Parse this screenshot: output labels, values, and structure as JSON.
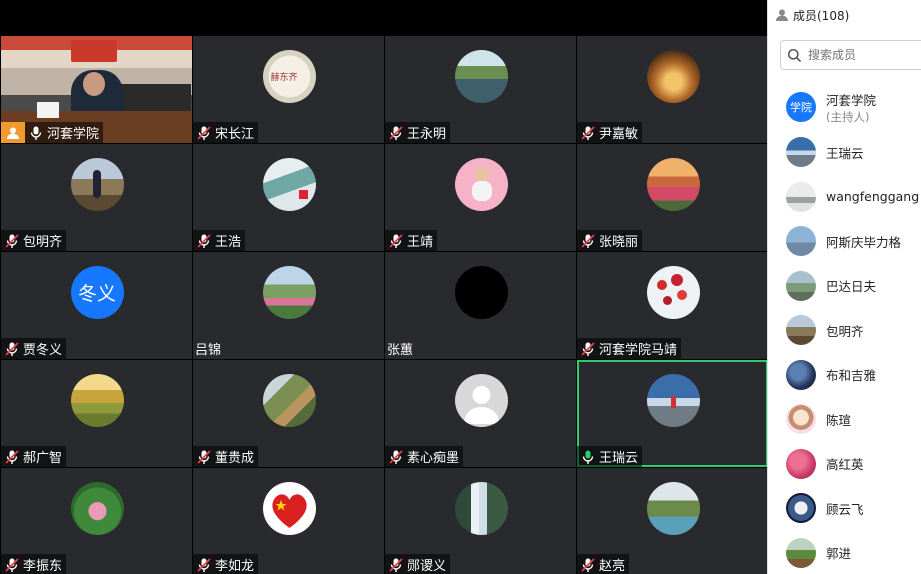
{
  "colors": {
    "tile_bg": "#292a2e",
    "active_border": "#2ecc71",
    "host_badge": "#f29a2e",
    "avatar_text_bg": "#1677ff",
    "mic_active": "#2ecc71"
  },
  "participants": [
    {
      "name": "河套学院",
      "mic": "on",
      "video": true,
      "host": true
    },
    {
      "name": "宋长江",
      "mic": "muted",
      "avatar": "seal-photo"
    },
    {
      "name": "王永明",
      "mic": "muted",
      "avatar": "lake-photo"
    },
    {
      "name": "尹嘉敏",
      "mic": "muted",
      "avatar": "sunset-hand-photo"
    },
    {
      "name": "包明齐",
      "mic": "muted",
      "avatar": "person-road-photo"
    },
    {
      "name": "王浩",
      "mic": "muted",
      "avatar": "painting-photo"
    },
    {
      "name": "王靖",
      "mic": "muted",
      "avatar": "child-pink-photo"
    },
    {
      "name": "张晓丽",
      "mic": "muted",
      "avatar": "flower-field-photo"
    },
    {
      "name": "贾冬义",
      "mic": "muted",
      "avatar_text": "冬义"
    },
    {
      "name": "吕锦",
      "mic": "none",
      "avatar": "tea-hills-photo"
    },
    {
      "name": "张蕙",
      "mic": "none",
      "avatar": "black-circle"
    },
    {
      "name": "河套学院马靖",
      "mic": "muted",
      "avatar": "red-blossom-photo"
    },
    {
      "name": "郝广智",
      "mic": "muted",
      "avatar": "golden-field-photo"
    },
    {
      "name": "董贵成",
      "mic": "muted",
      "avatar": "great-wall-photo"
    },
    {
      "name": "素心痴墨",
      "mic": "muted",
      "avatar": "default-person-icon"
    },
    {
      "name": "王瑞云",
      "mic": "on",
      "active": true,
      "avatar": "mountain-sky-photo"
    },
    {
      "name": "李振东",
      "mic": "muted",
      "avatar": "lotus-photo"
    },
    {
      "name": "李如龙",
      "mic": "muted",
      "avatar": "flag-heart-photo"
    },
    {
      "name": "郧谡义",
      "mic": "muted",
      "avatar": "waterfall-photo"
    },
    {
      "name": "赵亮",
      "mic": "muted",
      "avatar": "palm-pool-photo"
    }
  ],
  "sidebar": {
    "title": "成员(108)",
    "search_placeholder": "搜索成员",
    "members": [
      {
        "name": "河套学院",
        "subtitle": "(主持人)",
        "avatar_text": "学院"
      },
      {
        "name": "王瑞云",
        "avatar": "mountain-sky-photo"
      },
      {
        "name": "wangfenggang",
        "avatar": "misty-photo"
      },
      {
        "name": "阿斯庆毕力格",
        "avatar": "sky-photo"
      },
      {
        "name": "巴达日夫",
        "avatar": "landscape-photo"
      },
      {
        "name": "包明齐",
        "avatar": "person-road-photo"
      },
      {
        "name": "布和吉雅",
        "avatar": "night-city-photo"
      },
      {
        "name": "陈瑄",
        "avatar": "cartoon-girl-photo"
      },
      {
        "name": "高红英",
        "avatar": "pink-flowers-photo"
      },
      {
        "name": "顾云飞",
        "avatar": "moon-photo"
      },
      {
        "name": "郭进",
        "avatar": "hills-photo"
      }
    ]
  }
}
